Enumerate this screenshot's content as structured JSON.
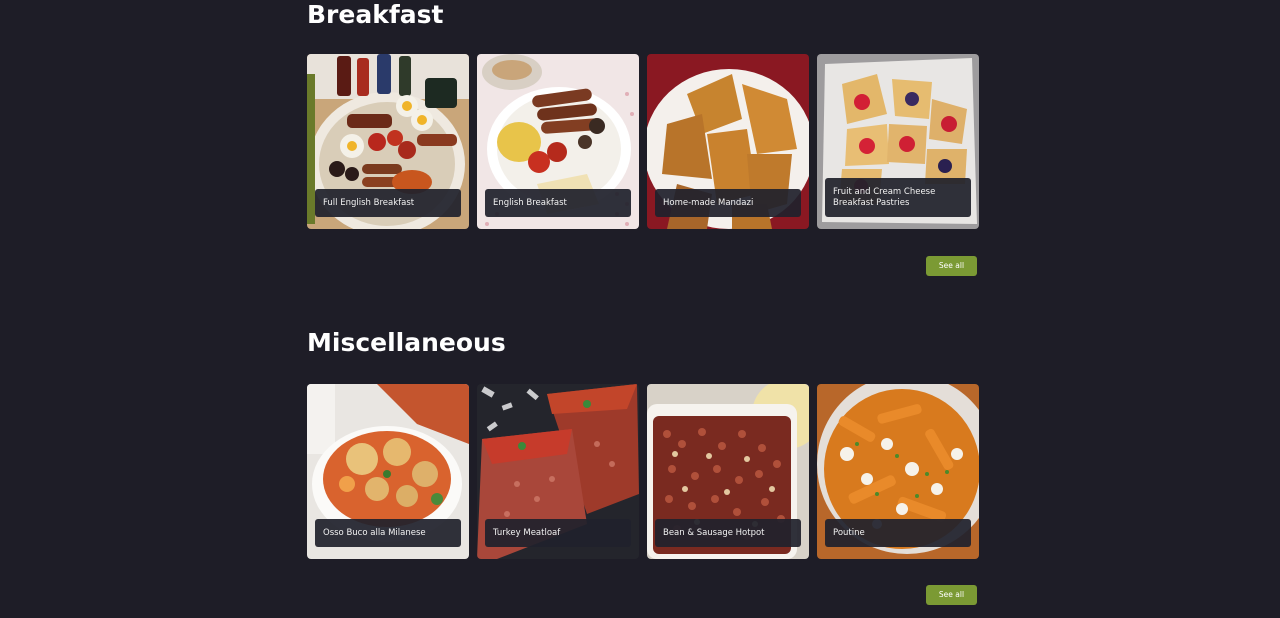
{
  "sections": [
    {
      "title": "Breakfast",
      "see_all_label": "See all",
      "cards": [
        {
          "label": "Full English Breakfast"
        },
        {
          "label": "English Breakfast"
        },
        {
          "label": "Home-made Mandazi"
        },
        {
          "label": "Fruit and Cream Cheese Breakfast Pastries"
        }
      ]
    },
    {
      "title": "Miscellaneous",
      "see_all_label": "See all",
      "cards": [
        {
          "label": "Osso Buco alla Milanese"
        },
        {
          "label": "Turkey Meatloaf"
        },
        {
          "label": "Bean & Sausage Hotpot"
        },
        {
          "label": "Poutine"
        }
      ]
    }
  ],
  "colors": {
    "background": "#1e1d27",
    "accent": "#7b9a34",
    "caption_bg": "#20212c"
  }
}
